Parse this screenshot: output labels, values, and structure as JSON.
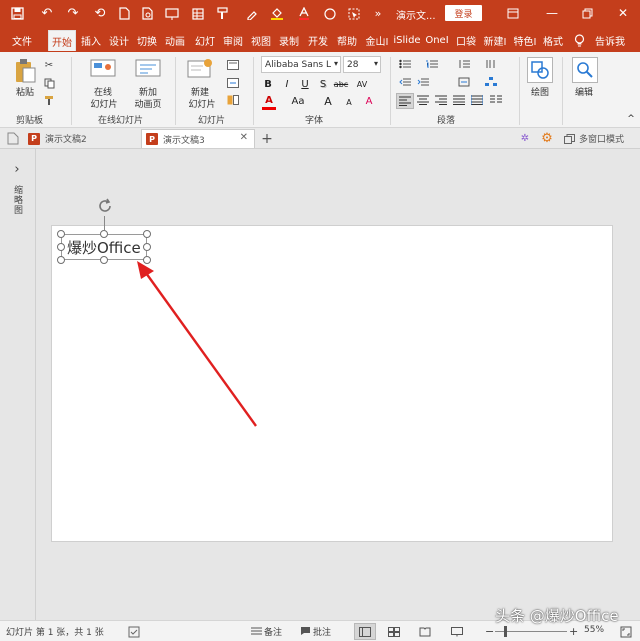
{
  "colors": {
    "accent": "#c43e1c",
    "arrow": "#e02020"
  },
  "titlebar": {
    "doc_title": "演示文...",
    "login_label": "登录",
    "quick_access_icons": [
      "save-icon",
      "undo-icon",
      "redo-icon",
      "reset-icon",
      "new-icon",
      "print-preview-icon",
      "present-icon",
      "table-icon",
      "format-painter-icon",
      "eyedropper-icon",
      "fill-color-icon",
      "font-color-icon",
      "shape-oval-icon",
      "select-icon",
      "more-icon"
    ],
    "window_controls": [
      "ribbon-display-icon",
      "minimize-icon",
      "restore-icon",
      "close-icon"
    ]
  },
  "tabs": [
    {
      "label": "文件"
    },
    {
      "label": "开始"
    },
    {
      "label": "插入"
    },
    {
      "label": "设计"
    },
    {
      "label": "切换"
    },
    {
      "label": "动画"
    },
    {
      "label": "幻灯"
    },
    {
      "label": "审阅"
    },
    {
      "label": "视图"
    },
    {
      "label": "录制"
    },
    {
      "label": "开发"
    },
    {
      "label": "帮助"
    },
    {
      "label": "金山I"
    },
    {
      "label": "iSlide"
    },
    {
      "label": "OneI"
    },
    {
      "label": "口袋"
    },
    {
      "label": "新建I"
    },
    {
      "label": "特色I"
    },
    {
      "label": "格式"
    },
    {
      "label": "告诉我"
    }
  ],
  "ribbon": {
    "clipboard": {
      "paste": "粘贴",
      "group": "剪贴板"
    },
    "online_slides": {
      "online": "在线",
      "online2": "幻灯片",
      "new_anim": "新加",
      "new_anim2": "动画页",
      "group": "在线幻灯片"
    },
    "slides": {
      "new_slide": "新建",
      "new_slide2": "幻灯片",
      "group": "幻灯片"
    },
    "font": {
      "family": "Alibaba Sans L",
      "size": "28",
      "group": "字体",
      "bold": "B",
      "italic": "I",
      "underline": "U",
      "shadow": "S",
      "strike": "abc",
      "spacing": "AV",
      "color_a": "A",
      "case": "Aa",
      "grow": "A",
      "shrink": "A",
      "clear": "A"
    },
    "paragraph": {
      "group": "段落"
    },
    "drawing": {
      "label": "绘图"
    },
    "editing": {
      "label": "编辑"
    }
  },
  "doc_tabs": [
    {
      "label": "演示文稿2"
    },
    {
      "label": "演示文稿3"
    }
  ],
  "doc_tabs_extra": {
    "add": "+",
    "multi_window": "多窗口模式"
  },
  "left_pane": {
    "label": "缩略图",
    "expand": "›"
  },
  "slide": {
    "textbox": "爆炒Office"
  },
  "statusbar": {
    "slide_info": "幻灯片 第 1 张，共 1 张",
    "notes": "备注",
    "comments": "批注",
    "zoom": "55%",
    "minus": "−",
    "plus": "+"
  },
  "watermark": "头条 @爆炒Office"
}
